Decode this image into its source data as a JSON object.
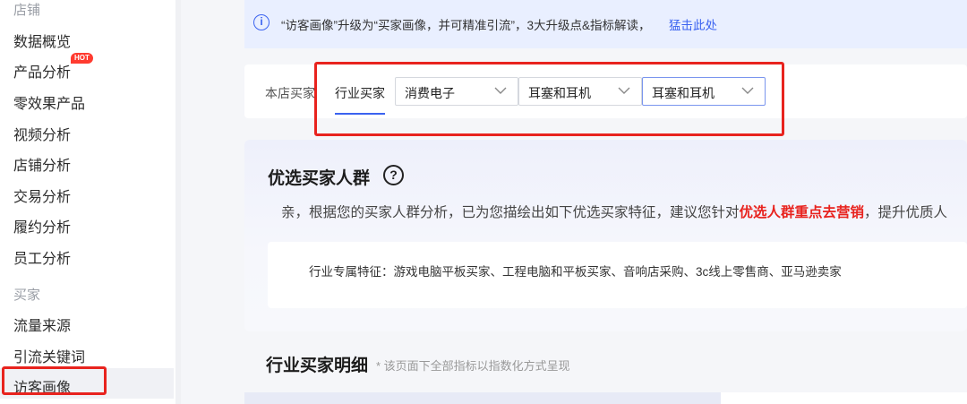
{
  "sidebar": {
    "section_store": "店铺",
    "store_items": [
      {
        "label": "数据概览"
      },
      {
        "label": "产品分析",
        "badge": "HOT"
      },
      {
        "label": "零效果产品"
      },
      {
        "label": "视频分析"
      },
      {
        "label": "店铺分析"
      },
      {
        "label": "交易分析"
      },
      {
        "label": "履约分析"
      },
      {
        "label": "员工分析"
      }
    ],
    "section_buyer": "买家",
    "buyer_items": [
      {
        "label": "流量来源"
      },
      {
        "label": "引流关键词"
      },
      {
        "label": "访客画像",
        "active": true
      }
    ]
  },
  "info_bar": {
    "icon": "info-icon",
    "text": "“访客画像”升级为“买家画像，并可精准引流”，3大升级点&指标解读，",
    "link": "猛击此处"
  },
  "filters": {
    "tabs": [
      {
        "label": "本店买家",
        "active": false
      },
      {
        "label": "行业买家",
        "active": true
      }
    ],
    "selects": [
      {
        "value": "消费电子"
      },
      {
        "value": "耳塞和耳机"
      },
      {
        "value": "耳塞和耳机"
      }
    ]
  },
  "preferred": {
    "title": "优选买家人群",
    "help_icon": "?",
    "desc_prefix": "亲，根据您的买家人群分析，已为您描绘出如下优选买家特征，建议您针对",
    "desc_highlight": "优选人群重点去营销",
    "desc_suffix": "，提升优质人",
    "feature_text": "行业专属特征：游戏电脑平板买家、工程电脑和平板买家、音响店采购、3c线上零售商、亚马逊卖家"
  },
  "detail": {
    "title": "行业买家明细",
    "note": "* 该页面下全部指标以指数化方式呈现"
  },
  "colors": {
    "accent": "#3b63f0",
    "highlight_red": "#e8231e",
    "info_bg": "#e9efff"
  }
}
